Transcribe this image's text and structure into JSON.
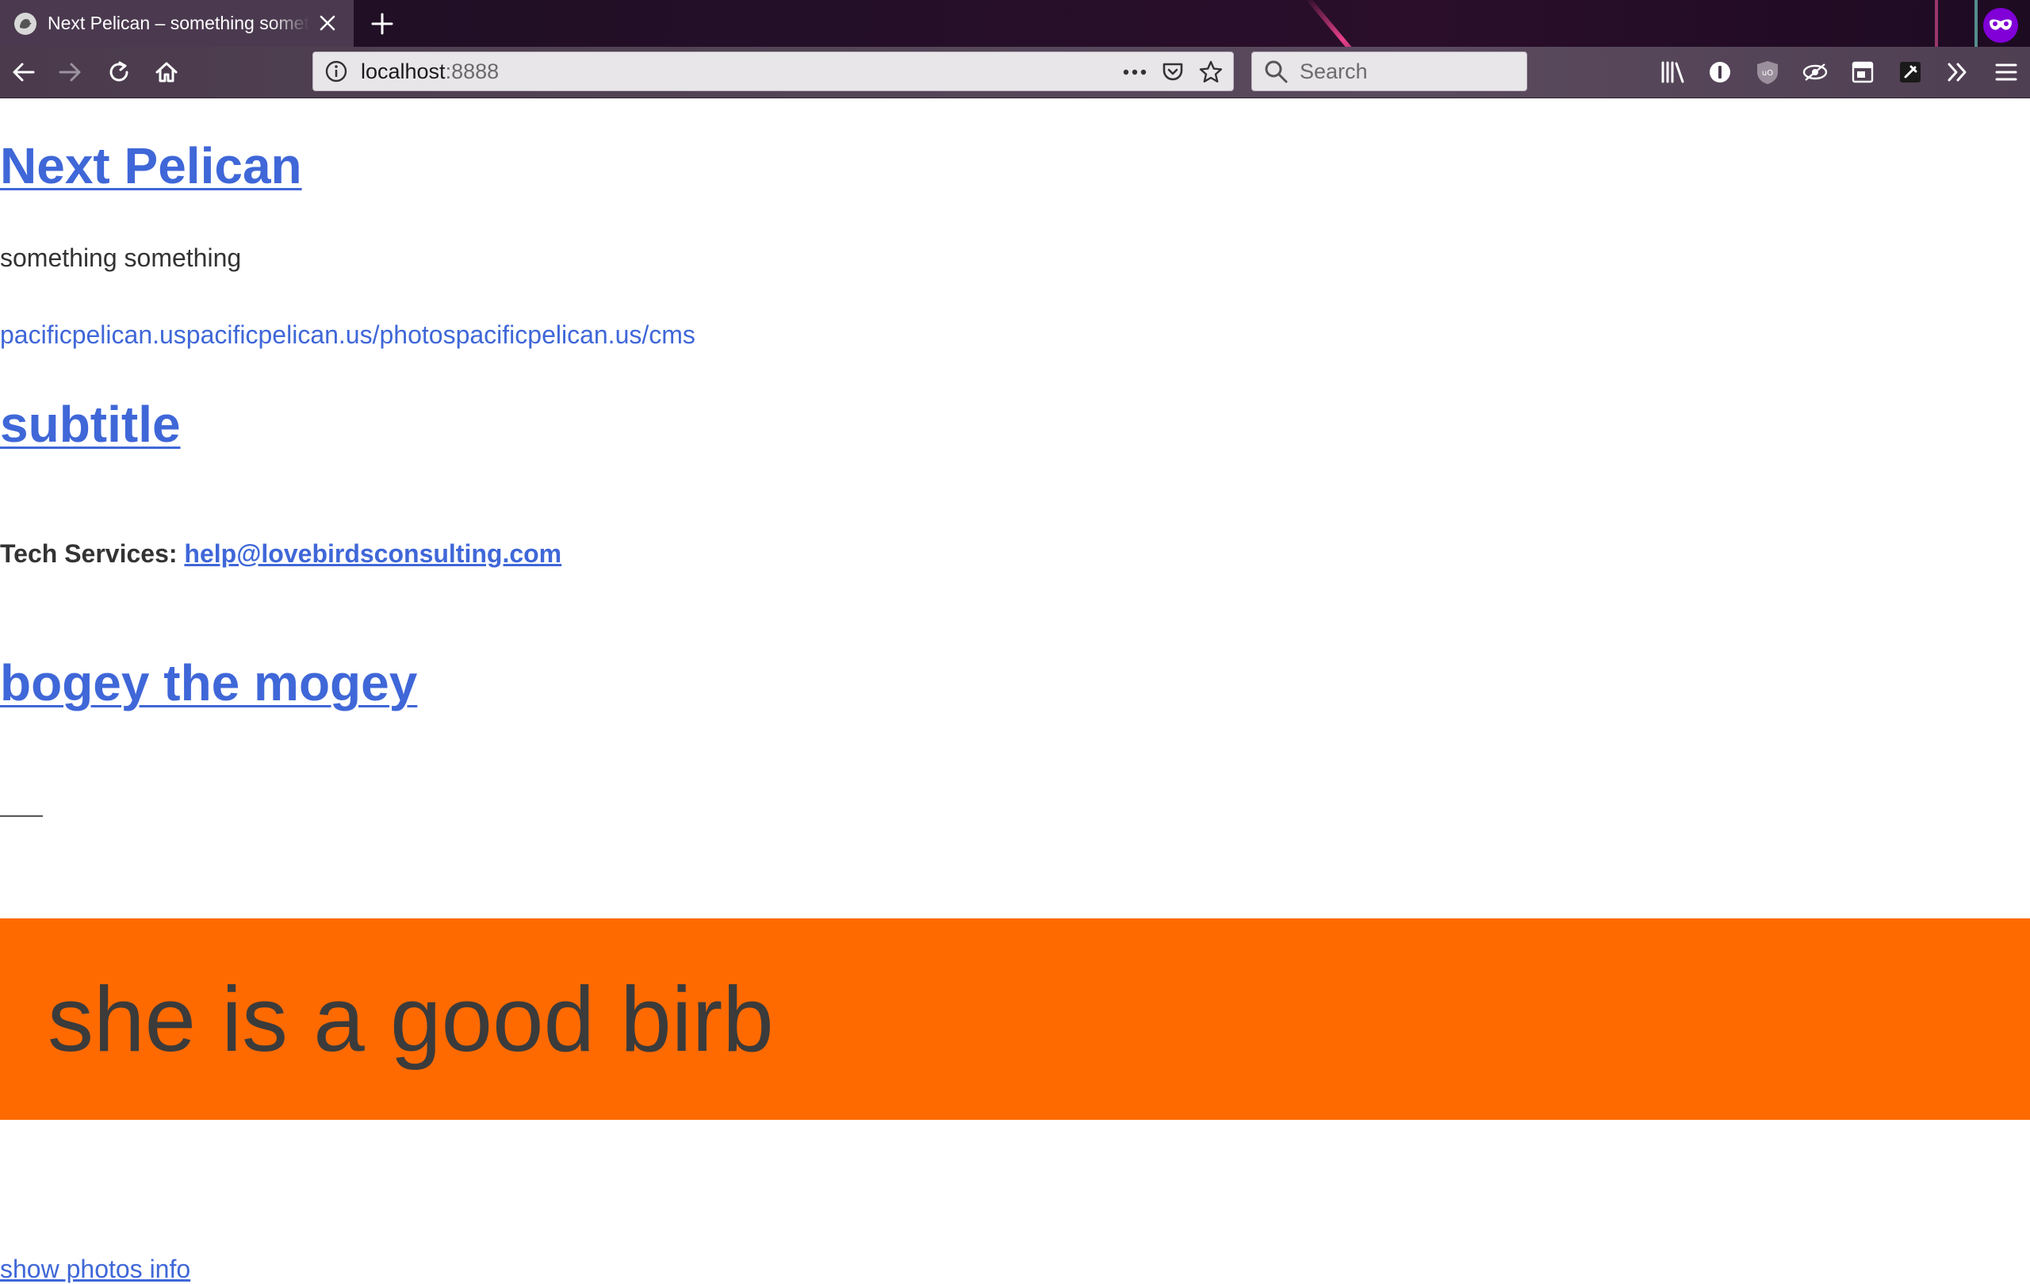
{
  "browser": {
    "tab": {
      "title": "Next Pelican – something something"
    },
    "url": {
      "host": "localhost",
      "port": ":8888"
    },
    "search": {
      "placeholder": "Search"
    }
  },
  "page": {
    "site_title": "Next Pelican",
    "tagline": "something something",
    "links": [
      {
        "text": "pacificpelican.us"
      },
      {
        "text": "pacificpelican.us/photos"
      },
      {
        "text": "pacificpelican.us/cms"
      }
    ],
    "subtitle": "subtitle",
    "tech_label": "Tech Services:",
    "tech_email": "help@lovebirdsconsulting.com",
    "bogey_heading": "bogey the mogey",
    "banner_text": "she is a good birb",
    "banner_color": "#ff6a00",
    "bottom_link": "show photos info"
  }
}
